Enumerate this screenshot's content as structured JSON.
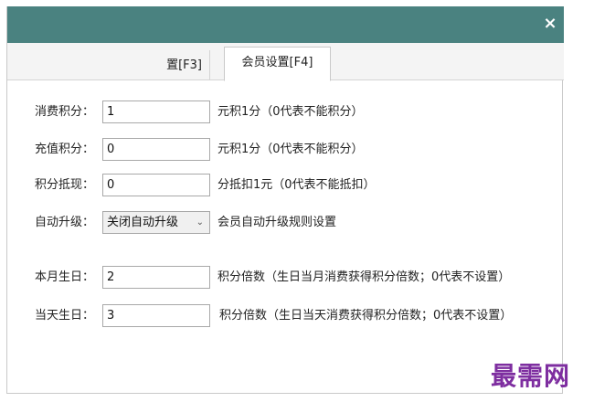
{
  "window": {
    "close_symbol": "×"
  },
  "tabs": [
    {
      "label": "置[F3]",
      "active": false
    },
    {
      "label": "会员设置[F4]",
      "active": true
    }
  ],
  "rows": [
    {
      "label": "消费积分：",
      "value": "1",
      "desc": "元积1分（0代表不能积分）"
    },
    {
      "label": "充值积分：",
      "value": "0",
      "desc": "元积1分（0代表不能积分）"
    },
    {
      "label": "积分抵现：",
      "value": "0",
      "desc": "分抵扣1元（0代表不能抵扣）"
    },
    {
      "label": "自动升级：",
      "value": "关闭自动升级",
      "desc": "会员自动升级规则设置"
    },
    {
      "label": "本月生日：",
      "value": "2",
      "desc": "积分倍数（生日当月消费获得积分倍数；0代表不设置）"
    },
    {
      "label": "当天生日：",
      "value": "3",
      "desc": "积分倍数（生日当天消费获得积分倍数；0代表不设置）"
    }
  ],
  "watermark": {
    "text": "最需网"
  },
  "colors": {
    "titlebar": "#4a8280",
    "watermark": "#7e2ea0"
  }
}
